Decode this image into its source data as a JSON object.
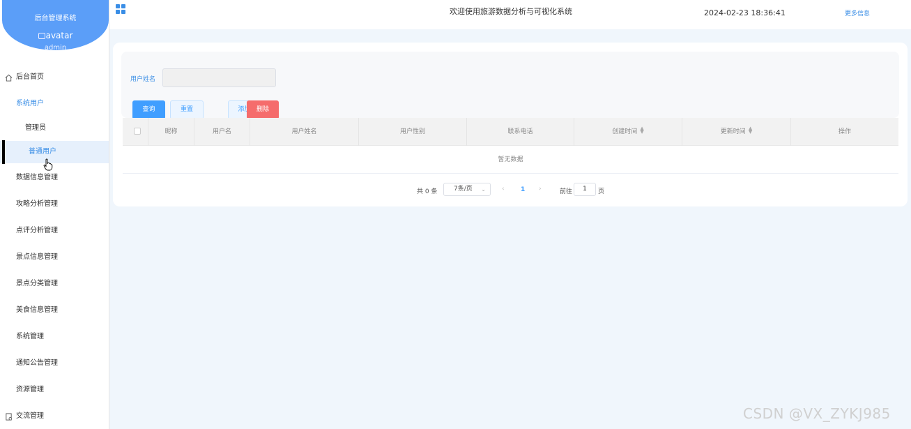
{
  "sidebar": {
    "system_name": "后台管理系统",
    "avatar_alt": "avatar",
    "username": "admin",
    "items": {
      "home": "后台首页",
      "system_users": "系统用户",
      "admins": "管理员",
      "normal_users": "普通用户",
      "data_info": "数据信息管理",
      "strategy": "攻略分析管理",
      "review": "点评分析管理",
      "scenic_info": "景点信息管理",
      "scenic_category": "景点分类管理",
      "food": "美食信息管理",
      "system_mgmt": "系统管理",
      "notice": "通知公告管理",
      "resource": "资源管理",
      "exchange": "交流管理"
    }
  },
  "header": {
    "welcome": "欢迎使用旅游数据分析与可视化系统",
    "datetime": "2024-02-23 18:36:41",
    "more": "更多信息"
  },
  "filter": {
    "label": "用户姓名",
    "value": "",
    "search": "查询",
    "reset": "重置",
    "add": "添加",
    "delete": "删除"
  },
  "table": {
    "columns": {
      "nickname": "昵称",
      "username": "用户名",
      "realname": "用户姓名",
      "gender": "用户性别",
      "phone": "联系电话",
      "created": "创建时间",
      "updated": "更新时间",
      "actions": "操作"
    },
    "empty": "暂无数据"
  },
  "pager": {
    "total": "共 0 条",
    "page_size": "7条/页",
    "current": "1",
    "goto": "前往",
    "goto_value": "1",
    "page_unit": "页"
  },
  "watermark": "CSDN @VX_ZYKJ985",
  "colors": {
    "primary": "#409eff",
    "danger": "#f56c6c",
    "sidebar_head": "#5b9ef8"
  }
}
